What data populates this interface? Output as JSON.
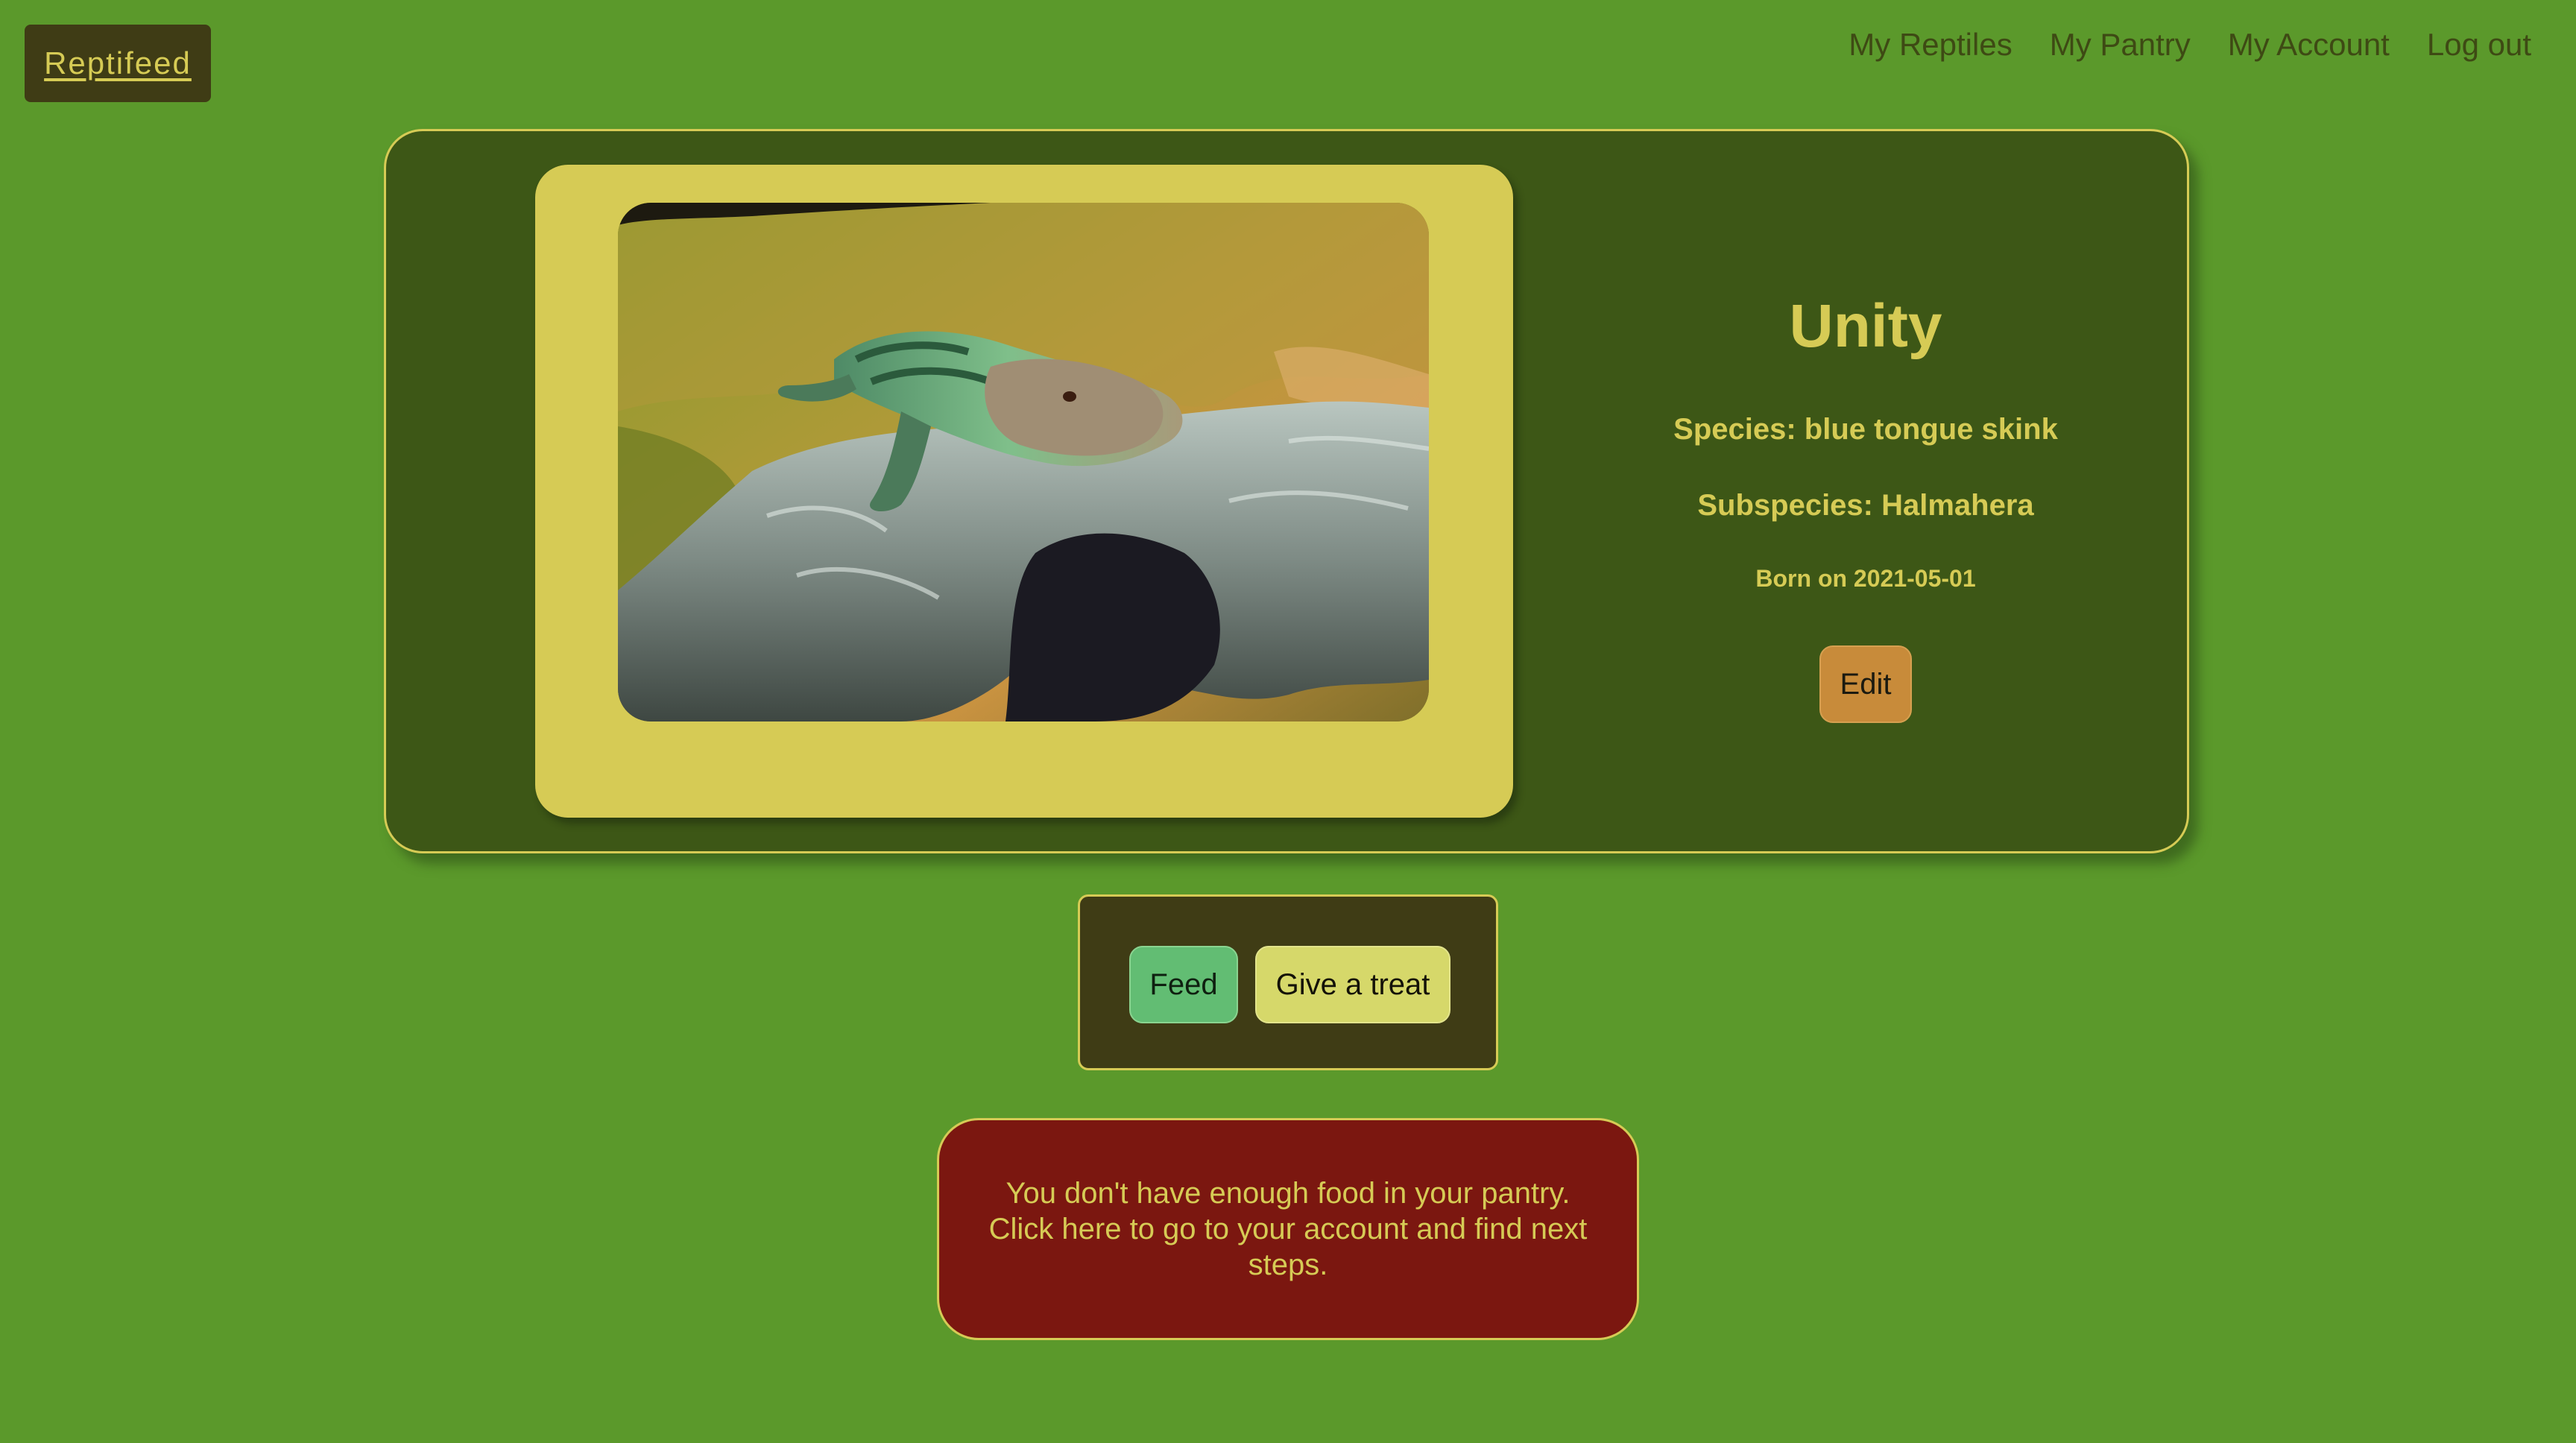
{
  "header": {
    "brand": "Reptifeed",
    "nav": [
      "My Reptiles",
      "My Pantry",
      "My Account",
      "Log out"
    ]
  },
  "reptile": {
    "name": "Unity",
    "species": "Species: blue tongue skink",
    "subspecies": "Subspecies: Halmahera",
    "born": "Born on 2021-05-01",
    "edit_label": "Edit"
  },
  "actions": {
    "feed_label": "Feed",
    "treat_label": "Give a treat"
  },
  "alert": {
    "message": "You don't have enough food in your pantry. Click here to go to your account and find next steps."
  },
  "colors": {
    "background": "#5b992b",
    "card": "#3d5716",
    "accent": "#d6cb55",
    "dark": "#3f3c15",
    "edit_button": "#c88b3a",
    "feed_button": "#62bd73",
    "treat_button": "#d6d86a",
    "alert": "#7b1710"
  }
}
